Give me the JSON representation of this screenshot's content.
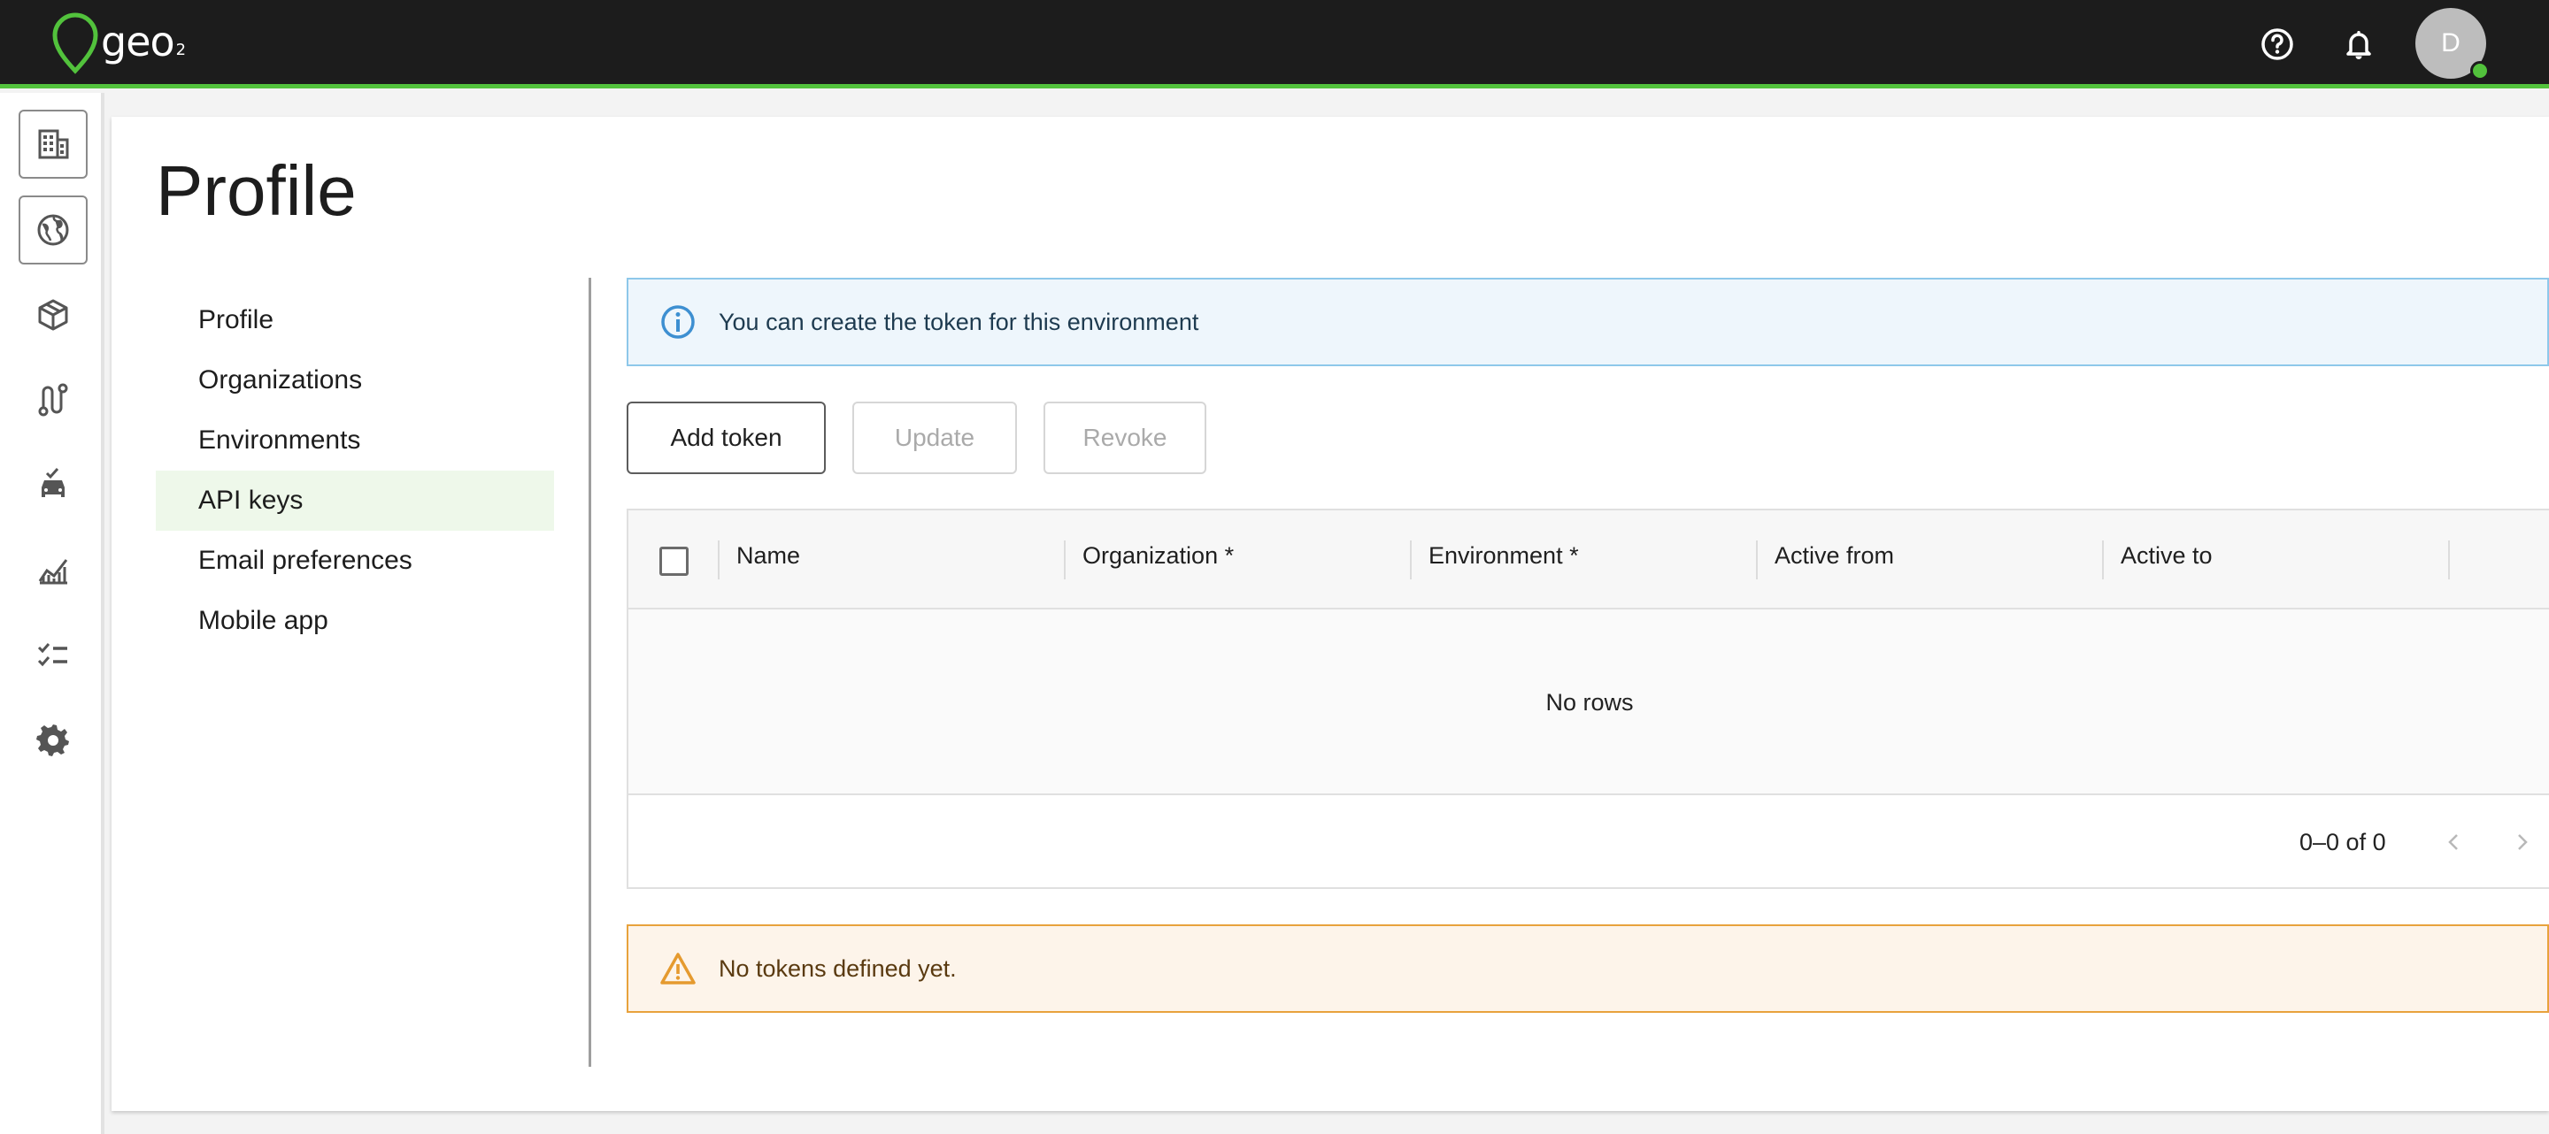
{
  "app": {
    "logo_text": "geo",
    "logo_sub": "2",
    "avatar_initial": "D",
    "accent_color": "#52c23c"
  },
  "topbar": {
    "icons": [
      "help-icon",
      "notifications-icon"
    ]
  },
  "rail": {
    "items": [
      "organizations-icon",
      "environments-globe-icon",
      "packages-icon",
      "routes-icon",
      "vehicles-icon",
      "analytics-icon",
      "tasks-icon",
      "settings-icon"
    ]
  },
  "page": {
    "title": "Profile"
  },
  "side_menu": {
    "items": [
      {
        "label": "Profile"
      },
      {
        "label": "Organizations"
      },
      {
        "label": "Environments"
      },
      {
        "label": "API keys",
        "active": true
      },
      {
        "label": "Email preferences"
      },
      {
        "label": "Mobile app"
      }
    ]
  },
  "info_alert": {
    "text": "You can create the token for this environment"
  },
  "toolbar": {
    "add_label": "Add token",
    "update_label": "Update",
    "revoke_label": "Revoke"
  },
  "grid": {
    "columns": [
      "Name",
      "Organization *",
      "Environment *",
      "Active from",
      "Active to"
    ],
    "empty_text": "No rows",
    "pagination": "0–0 of 0"
  },
  "warning_alert": {
    "text": "No tokens defined yet."
  }
}
